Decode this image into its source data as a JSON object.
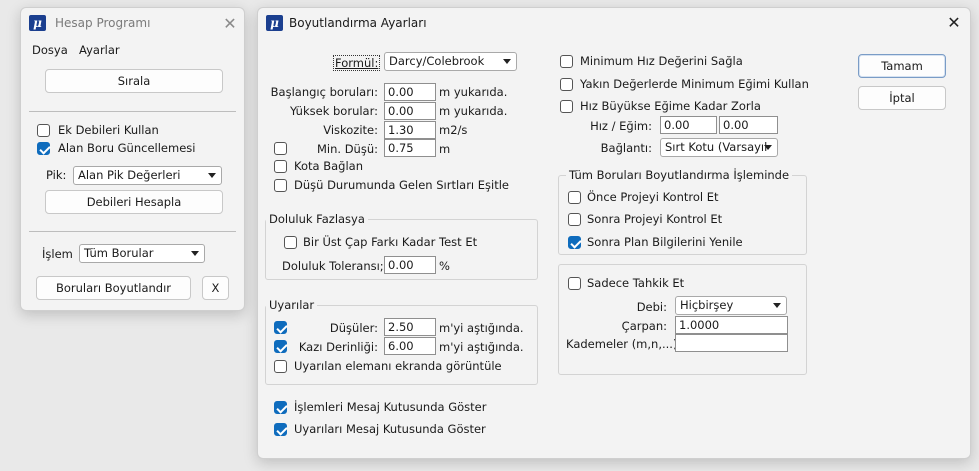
{
  "hesap_window": {
    "title": "Hesap Programı",
    "menu": [
      "Dosya",
      "Ayarlar"
    ],
    "sort_button": "Sırala",
    "ek_debiler": {
      "label": "Ek Debileri Kullan",
      "checked": false
    },
    "alan_boru": {
      "label": "Alan Boru Güncellemesi",
      "checked": true
    },
    "pik_label": "Pik:",
    "pik_value": "Alan Pik Değerleri",
    "calc_button": "Debileri Hesapla",
    "islem_label": "İşlem",
    "islem_value": "Tüm Borular",
    "size_button": "Boruları Boyutlandır",
    "x_button": "X"
  },
  "settings_window": {
    "title": "Boyutlandırma Ayarları",
    "formul_label": "Formül:",
    "formul_value": "Darcy/Colebrook",
    "baslangic": {
      "label": "Başlangıç boruları:",
      "value": "0.00",
      "unit": "m yukarıda."
    },
    "yuksek": {
      "label": "Yüksek borular:",
      "value": "0.00",
      "unit": "m yukarıda."
    },
    "viskozite": {
      "label": "Viskozite:",
      "value": "1.30",
      "unit": "m2/s"
    },
    "min_dusu": {
      "label": "Min. Düşü:",
      "value": "0.75",
      "unit": "m",
      "checked": false
    },
    "kota_baglan": {
      "label": "Kota Bağlan",
      "checked": false
    },
    "dusu_durumunda": {
      "label": "Düşü Durumunda Gelen Sırtları Eşitle",
      "checked": false
    },
    "doluluk": {
      "title": "Doluluk Fazlasya",
      "bir_ust": {
        "label": "Bir Üst Çap Farkı Kadar Test Et",
        "checked": false
      },
      "tolerans_label": "Doluluk Toleransı;",
      "tolerans_value": "0.00",
      "tolerans_unit": "%"
    },
    "uyarilar": {
      "title": "Uyarılar",
      "dusuler": {
        "label": "Düşüler:",
        "value": "2.50",
        "unit": "m'yi aştığında.",
        "checked": true
      },
      "kazi": {
        "label": "Kazı Derinliği:",
        "value": "6.00",
        "unit": "m'yi aştığında.",
        "checked": true
      },
      "uyarilan": {
        "label": "Uyarılan elemanı ekranda görüntüle",
        "checked": false
      }
    },
    "islemleri_mesaj": {
      "label": "İşlemleri Mesaj Kutusunda Göster",
      "checked": true
    },
    "uyarilari_mesaj": {
      "label": "Uyarıları Mesaj Kutusunda Göster",
      "checked": true
    },
    "min_hiz": {
      "label": "Minimum Hız Değerini Sağla",
      "checked": false
    },
    "yakin_deger": {
      "label": "Yakın Değerlerde Minimum Eğimi Kullan",
      "checked": false
    },
    "hiz_buyukse": {
      "label": "Hız Büyükse Eğime Kadar Zorla",
      "checked": false
    },
    "hiz_egim": {
      "label": "Hız / Eğim:",
      "value1": "0.00",
      "value2": "0.00"
    },
    "baglanti": {
      "label": "Bağlantı:",
      "value": "Sırt Kotu (Varsayıl"
    },
    "tum_borular": {
      "title": "Tüm Boruları Boyutlandırma İşleminde",
      "once": {
        "label": "Önce Projeyi Kontrol Et",
        "checked": false
      },
      "sonra": {
        "label": "Sonra Projeyi Kontrol Et",
        "checked": false
      },
      "sonra_plan": {
        "label": "Sonra Plan Bilgilerini Yenile",
        "checked": true
      }
    },
    "tahkik": {
      "sadece": {
        "label": "Sadece Tahkik Et",
        "checked": false
      },
      "debi_label": "Debi:",
      "debi_value": "Hiçbirşey",
      "carpan_label": "Çarpan:",
      "carpan_value": "1.0000",
      "kademeler_label": "Kademeler (m,n,...):",
      "kademeler_value": ""
    },
    "ok_button": "Tamam",
    "cancel_button": "İptal"
  },
  "colors": {
    "accent": "#0f6cbd",
    "logo": "#1b3f8f",
    "window_bg": "#f3f3f3"
  }
}
